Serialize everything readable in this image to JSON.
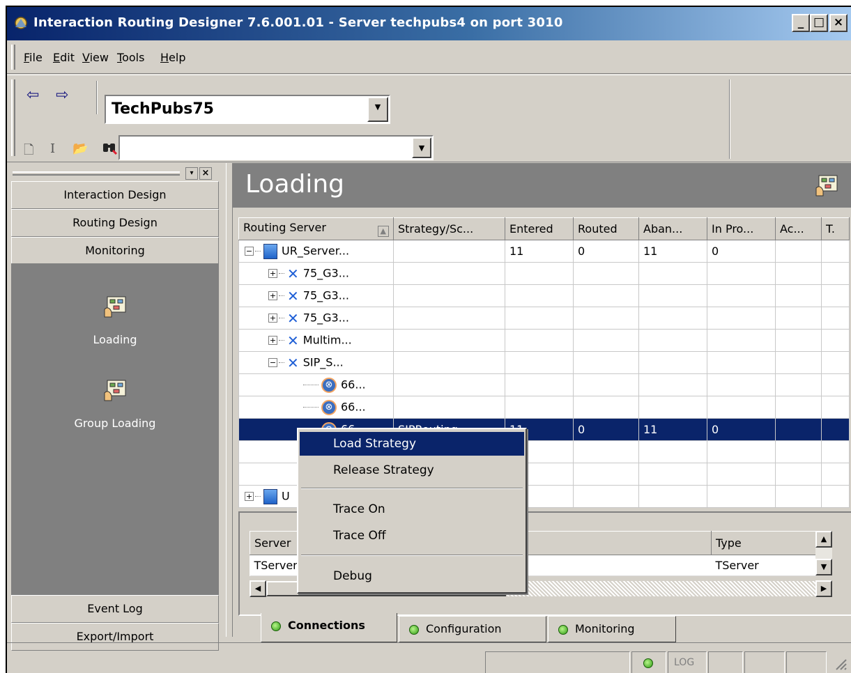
{
  "window": {
    "title": "Interaction Routing Designer  7.6.001.01  - Server techpubs4 on port 3010",
    "controls": [
      "_",
      "□",
      "×"
    ]
  },
  "menu": [
    "File",
    "Edit",
    "View",
    "Tools",
    "Help"
  ],
  "toolbar": {
    "tenant_combo_value": "TechPubs75",
    "search_combo_value": "",
    "icons": [
      "back-arrow-icon",
      "forward-arrow-icon",
      "new-document-icon",
      "text-cursor-icon",
      "open-folder-icon",
      "find-binoculars-icon"
    ]
  },
  "nav": {
    "buttons": [
      "Interaction Design",
      "Routing Design",
      "Monitoring",
      "Event Log",
      "Export/Import"
    ],
    "tiles": [
      "Loading",
      "Group Loading"
    ]
  },
  "main": {
    "title": "Loading",
    "columns": [
      "Routing Server",
      "Strategy/Sc...",
      "Entered",
      "Routed",
      "Aban...",
      "In Pro...",
      "Ac...",
      "T."
    ],
    "rows": [
      {
        "label": "UR_Server...",
        "strategy": "",
        "entered": "11",
        "routed": "0",
        "aban": "11",
        "inpro": "0"
      },
      {
        "label": "75_G3...",
        "strategy": "",
        "entered": "",
        "routed": "",
        "aban": "",
        "inpro": ""
      },
      {
        "label": "75_G3...",
        "strategy": "",
        "entered": "",
        "routed": "",
        "aban": "",
        "inpro": ""
      },
      {
        "label": "75_G3...",
        "strategy": "",
        "entered": "",
        "routed": "",
        "aban": "",
        "inpro": ""
      },
      {
        "label": "Multim...",
        "strategy": "",
        "entered": "",
        "routed": "",
        "aban": "",
        "inpro": ""
      },
      {
        "label": "SIP_S...",
        "strategy": "",
        "entered": "",
        "routed": "",
        "aban": "",
        "inpro": ""
      },
      {
        "label": "66...",
        "strategy": "",
        "entered": "",
        "routed": "",
        "aban": "",
        "inpro": ""
      },
      {
        "label": "66...",
        "strategy": "",
        "entered": "",
        "routed": "",
        "aban": "",
        "inpro": ""
      },
      {
        "label": "66...",
        "strategy": "SIPRouting...",
        "entered": "11",
        "routed": "0",
        "aban": "11",
        "inpro": "0"
      },
      {
        "label": "",
        "strategy": "",
        "entered": "",
        "routed": "",
        "aban": "",
        "inpro": ""
      },
      {
        "label": "",
        "strategy": "",
        "entered": "",
        "routed": "",
        "aban": "",
        "inpro": ""
      },
      {
        "label": "U",
        "strategy": "",
        "entered": "",
        "routed": "",
        "aban": "",
        "inpro": ""
      }
    ]
  },
  "connections": {
    "columns": [
      "Server",
      "Type"
    ],
    "rows": [
      {
        "server": "TServer",
        "type": "TServer"
      }
    ]
  },
  "bottom_tabs": [
    "Connections",
    "Configuration",
    "Monitoring"
  ],
  "status": {
    "log_label": "LOG"
  },
  "context_menu": {
    "items": [
      "Load Strategy",
      "Release Strategy",
      "Trace On",
      "Trace Off",
      "Debug"
    ]
  }
}
